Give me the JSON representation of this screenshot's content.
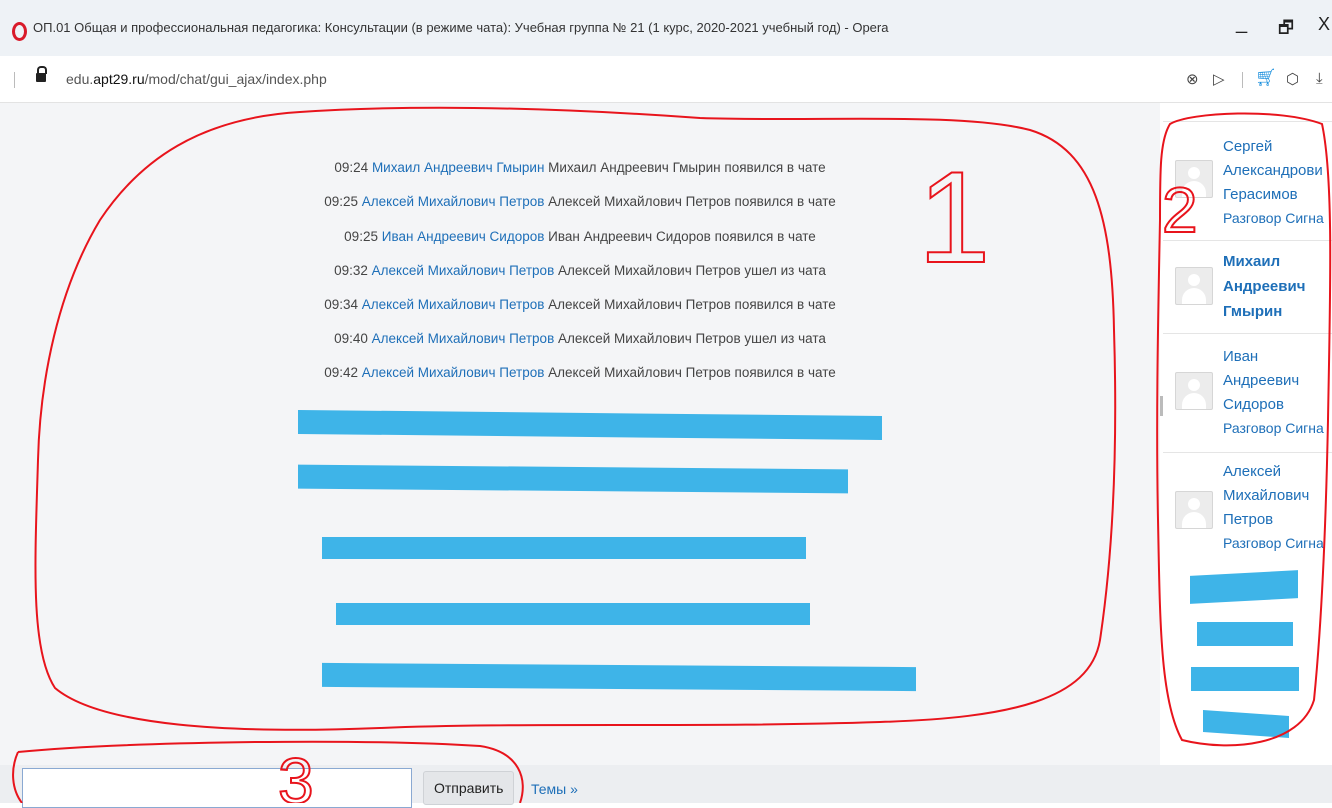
{
  "window": {
    "title": "ОП.01 Общая и профессиональная педагогика: Консультации (в режиме чата): Учебная группа № 21 (1 курс, 2020-2021 учебный год) - Opera",
    "minimize": "_",
    "restore": "🗗",
    "close": "X"
  },
  "address": {
    "domain_host": "edu.",
    "domain_main": "apt29.ru",
    "path": "/mod/chat/gui_ajax/index.php"
  },
  "messages": [
    {
      "time": "09:24",
      "user": "Михаил Андреевич Гмырин",
      "text": "Михаил Андреевич Гмырин появился в чате"
    },
    {
      "time": "09:25",
      "user": "Алексей Михайлович Петров",
      "text": "Алексей Михайлович Петров появился в чате"
    },
    {
      "time": "09:25",
      "user": "Иван Андреевич Сидоров",
      "text": "Иван Андреевич Сидоров появился в чате"
    },
    {
      "time": "09:32",
      "user": "Алексей Михайлович Петров",
      "text": "Алексей Михайлович Петров ушел из чата"
    },
    {
      "time": "09:34",
      "user": "Алексей Михайлович Петров",
      "text": "Алексей Михайлович Петров появился в чате"
    },
    {
      "time": "09:40",
      "user": "Алексей Михайлович Петров",
      "text": "Алексей Михайлович Петров ушел из чата"
    },
    {
      "time": "09:42",
      "user": "Алексей Михайлович Петров",
      "text": "Алексей Михайлович Петров появился в чате"
    }
  ],
  "users": [
    {
      "name_lines": [
        "Сергей",
        "Александрови",
        "Герасимов"
      ],
      "beep": "Разговор Сигна"
    },
    {
      "name_lines": [
        "Михаил",
        "Андреевич",
        "Гмырин"
      ],
      "beep": ""
    },
    {
      "name_lines": [
        "Иван",
        "Андреевич",
        "Сидоров"
      ],
      "beep": "Разговор Сигна"
    },
    {
      "name_lines": [
        "Алексей",
        "Михайлович",
        "Петров"
      ],
      "beep": "Разговор Сигна"
    }
  ],
  "annotations": [
    "1",
    "2",
    "3"
  ],
  "input": {
    "send_label": "Отправить",
    "themes_label": "Темы »"
  },
  "colors": {
    "link": "#1e6fb8",
    "redaction": "#3eb4e8",
    "annotation": "#e8141c"
  }
}
